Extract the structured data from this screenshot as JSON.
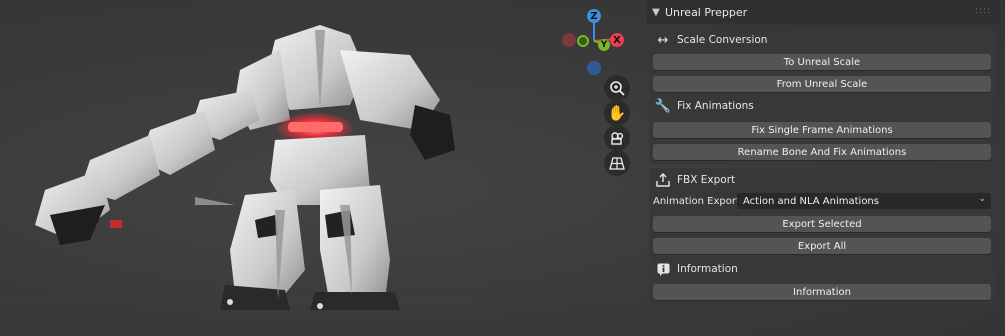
{
  "panel": {
    "title": "Unreal Prepper",
    "grip": "::::",
    "scale_conversion": {
      "title": "Scale Conversion",
      "to_button": "To Unreal Scale",
      "from_button": "From Unreal Scale"
    },
    "fix_animations": {
      "title": "Fix Animations",
      "single_frame_button": "Fix Single Frame Animations",
      "rename_bone_button": "Rename Bone And Fix Animations"
    },
    "fbx_export": {
      "title": "FBX Export",
      "animation_export_label": "Animation Export:",
      "animation_export_value": "Action and NLA Animations",
      "export_selected_button": "Export Selected",
      "export_all_button": "Export All"
    },
    "information": {
      "title": "Information",
      "button": "Information"
    }
  },
  "gizmo": {
    "z": "Z",
    "x": "X",
    "y": "Y",
    "colors": {
      "x": "#e8404f",
      "y": "#7bb528",
      "z": "#3f8fe0"
    }
  },
  "viewport_tools": [
    "zoom-icon",
    "hand-icon",
    "camera-icon",
    "grid-icon"
  ]
}
